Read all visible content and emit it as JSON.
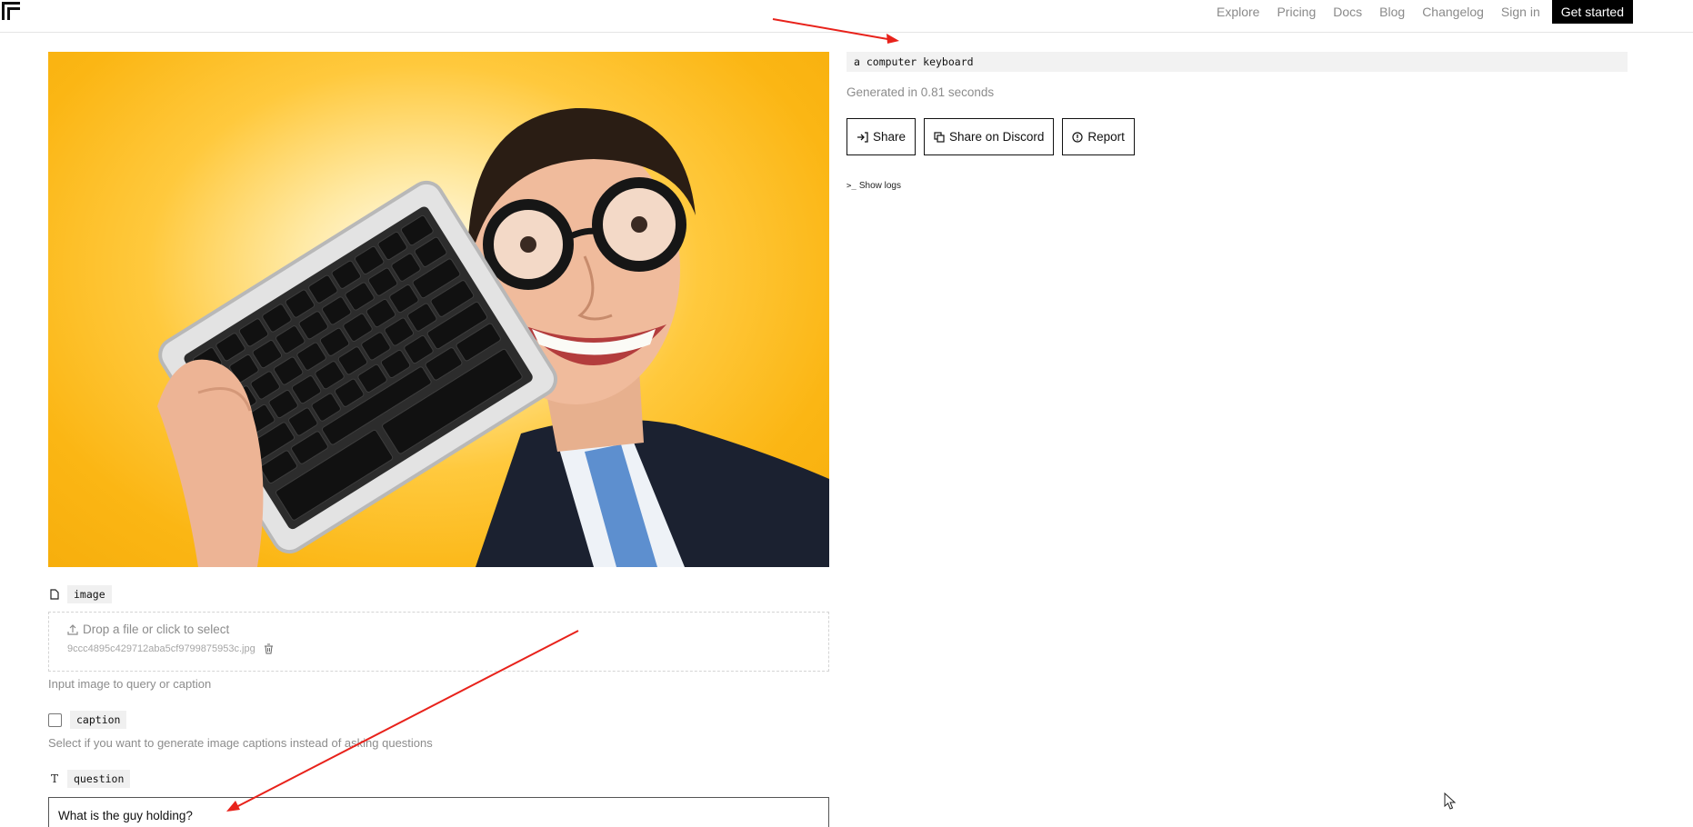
{
  "nav": {
    "links": [
      "Explore",
      "Pricing",
      "Docs",
      "Blog",
      "Changelog",
      "Sign in"
    ],
    "cta": "Get started"
  },
  "image_input": {
    "label": "image",
    "drop_text": "Drop a file or click to select",
    "file_name": "9ccc4895c429712aba5cf9799875953c.jpg",
    "hint": "Input image to query or caption"
  },
  "caption_input": {
    "label": "caption",
    "checked": false,
    "hint": "Select if you want to generate image captions instead of asking questions"
  },
  "question_input": {
    "label": "question",
    "value": "What is the guy holding?"
  },
  "output": {
    "text": "a computer keyboard",
    "generated": "Generated in 0.81 seconds",
    "buttons": {
      "share": "Share",
      "discord": "Share on Discord",
      "report": "Report"
    },
    "logs": "Show logs"
  },
  "colors": {
    "annotation_arrow": "#e8221b",
    "photo_background": "#fbb614"
  },
  "icons": [
    "logo-icon",
    "file-icon",
    "upload-icon",
    "trash-icon",
    "text-icon",
    "share-icon",
    "copy-icon",
    "alert-icon",
    "terminal-icon",
    "cursor-icon"
  ]
}
